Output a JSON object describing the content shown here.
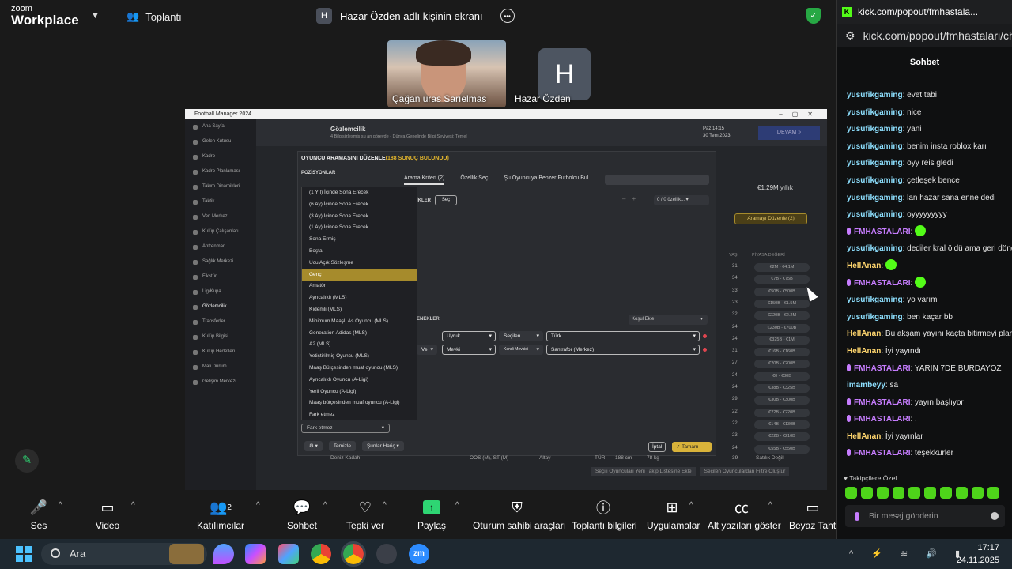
{
  "zoom": {
    "logo_top": "zoom",
    "logo_bottom": "Workplace",
    "meeting": "Toplantı",
    "shared_screen_title": "Hazar Özden adlı kişinin ekranı",
    "h_initial": "H"
  },
  "participants": [
    {
      "name": "Çağan uras Sarıelmas"
    },
    {
      "name": "Hazar Özden",
      "initial": "H"
    }
  ],
  "fm": {
    "window_title": "Football Manager 2024",
    "search_title": "Gözlemcilik",
    "search_sub": "4 Bilgisizleşmiş şu an görevde - Dünya Genelinde Bilgi Seviyesi: Temel",
    "date_line1": "Paz 14:15",
    "date_line2": "30 Tem 2023",
    "continue": "DEVAM",
    "sidebar": [
      "Ana Sayfa",
      "Gelen Kutusu",
      "Kadro",
      "Kadro Planlaması",
      "Takım Dinamikleri",
      "Taktik",
      "Veri Merkezi",
      "Kulüp Çalışanları",
      "Antrenman",
      "Sağlık Merkezi",
      "Fikstür",
      "Lig/Kupa",
      "Gözlemcilik",
      "Transferler",
      "Kulüp Bilgisi",
      "Kulüp Hedefleri",
      "Mali Durum",
      "Gelişim Merkezi"
    ],
    "dialog": {
      "title": "OYUNCU ARAMASINI DÜZENLE",
      "count": "(188 SONUÇ BULUNDU)",
      "positions": "POZİSYONLAR",
      "tabs": [
        "Arama Kriteri (2)",
        "Özellik Seç"
      ],
      "similar": "Şu Oyuncuya Benzer Futbolcu Bul",
      "ikler": "İKLER",
      "select_btn": "Seç",
      "features": "0 / 0 özellik...",
      "options_label": "ENEKLER",
      "add_condition": "Koşul Ekle",
      "row1": {
        "a": "Uyruk",
        "b": "Seçilen",
        "c": "Türk"
      },
      "connector": "Ve",
      "row2": {
        "a": "Mevki",
        "b": "Kendi Mevkisi",
        "c": "Santrafor (Merkez)"
      },
      "dropdown_selected": "Fark etmez",
      "clear": "Temizle",
      "exclude": "Şunlar Hariç",
      "cancel": "İptal",
      "ok": "Tamam"
    },
    "dropdown_options": [
      "(1 Yıl) İçinde Sona Erecek",
      "(6 Ay) İçinde Sona Erecek",
      "(3 Ay) İçinde Sona Erecek",
      "(1 Ay) İçinde Sona Erecek",
      "Sona Ermiş",
      "Boşta",
      "Ucu Açık Sözleşme",
      "Genç",
      "Amatör",
      "Ayrıcalıklı (MLS)",
      "Kıdemli (MLS)",
      "Minimum Maaşlı As Oyuncu (MLS)",
      "Generation Adidas (MLS)",
      "A2 (MLS)",
      "Yetiştirilmiş Oyuncu (MLS)",
      "Maaş Bütçesinden muaf oyuncu (MLS)",
      "Ayrıcalıklı Oyuncu (A-Ligi)",
      "Yerli Oyuncu (A-Ligi)",
      "Maaş bütçesinden muaf oyuncu (A-Ligi)",
      "Fark etmez"
    ],
    "selected_option": "Genç",
    "right_header": {
      "age": "YAŞ",
      "value": "PİYASA DEĞERİ",
      "balance": "€1.29M yıllık",
      "edit_search": "Aramayı Düzenle (2)"
    },
    "ages": [
      "31",
      "34",
      "33",
      "23",
      "32",
      "24",
      "24",
      "31",
      "27",
      "24",
      "24",
      "29",
      "22",
      "22",
      "23",
      "24",
      "39"
    ],
    "values": [
      "€2M - €4.1M",
      "€7B - €75B",
      "€50B - €500B",
      "€150B - €1.5M",
      "€220B - €2.2M",
      "€230B - €700B",
      "€325B - €1M",
      "€16B - €160B",
      "€20B - €200B",
      "€0 - €80B",
      "€38B - €325B",
      "€30B - €300B",
      "€22B - €220B",
      "€14B - €130B",
      "€22B - €210B",
      "€55B - €550B",
      "Satılık Değil"
    ],
    "bottom_row": {
      "name": "Deniz Kadah",
      "pos": "OOS (M), ST (M)",
      "club": "Altay",
      "nat": "TÜR",
      "height": "188 cm",
      "weight": "78 kg"
    },
    "action_left": "Seçili Oyuncuları Yeni Takip Listesine Ekle",
    "action_right": "Seçilen Oyunculardan Filtre Oluştur"
  },
  "browser": {
    "tab_title": "kick.com/popout/fmhastala...",
    "url": "kick.com/popout/fmhastalari/ch",
    "chat_title": "Sohbet",
    "followers_label": "Takipçilere Özel",
    "input_placeholder": "Bir mesaj gönderin"
  },
  "chat": [
    {
      "user": "yusufikgaming",
      "text": ": evet tabi",
      "color": "#8ee0ff"
    },
    {
      "user": "yusufikgaming",
      "text": ": nice",
      "color": "#8ee0ff"
    },
    {
      "user": "yusufikgaming",
      "text": ": yani",
      "color": "#8ee0ff"
    },
    {
      "user": "yusufikgaming",
      "text": ": benim insta roblox karı",
      "color": "#8ee0ff"
    },
    {
      "user": "yusufikgaming",
      "text": ": oyy reis gledi",
      "color": "#8ee0ff"
    },
    {
      "user": "yusufikgaming",
      "text": ": çetleşek bence",
      "color": "#8ee0ff"
    },
    {
      "user": "yusufikgaming",
      "text": ": lan hazar sana enne dedi",
      "color": "#8ee0ff"
    },
    {
      "user": "yusufikgaming",
      "text": ": oyyyyyyyyy",
      "color": "#8ee0ff"
    },
    {
      "user": "FMHASTALARI",
      "text": ": ",
      "color": "#c77dff",
      "mod": true,
      "emote": true
    },
    {
      "user": "yusufikgaming",
      "text": ": dediler kral öldü ama geri döndü",
      "color": "#8ee0ff"
    },
    {
      "user": "HellAnan",
      "text": ": ",
      "color": "#ffd66e",
      "emote": true
    },
    {
      "user": "FMHASTALARI",
      "text": ": ",
      "color": "#c77dff",
      "mod": true,
      "emote": true
    },
    {
      "user": "yusufikgaming",
      "text": ": yo varım",
      "color": "#8ee0ff"
    },
    {
      "user": "yusufikgaming",
      "text": ": ben kaçar bb",
      "color": "#8ee0ff"
    },
    {
      "user": "HellAnan",
      "text": ": Bu akşam yayını kaçta bitirmeyi planlıy",
      "color": "#ffd66e"
    },
    {
      "user": "HellAnan",
      "text": ": İyi yayındı",
      "color": "#ffd66e"
    },
    {
      "user": "FMHASTALARI",
      "text": ": YARIN 7DE BURDAYOZ",
      "color": "#c77dff",
      "mod": true
    },
    {
      "user": "imambeyy",
      "text": ": sa",
      "color": "#8ee0ff"
    },
    {
      "user": "FMHASTALARI",
      "text": ": yayın başlıyor",
      "color": "#c77dff",
      "mod": true
    },
    {
      "user": "FMHASTALARI",
      "text": ": .",
      "color": "#c77dff",
      "mod": true
    },
    {
      "user": "HellAnan",
      "text": ": İyi yayınlar",
      "color": "#ffd66e"
    },
    {
      "user": "FMHASTALARI",
      "text": ": teşekkürler",
      "color": "#c77dff",
      "mod": true
    }
  ],
  "toolbar": {
    "audio": "Ses",
    "video": "Video",
    "participants": "Katılımcılar",
    "participants_count": "2",
    "chat": "Sohbet",
    "react": "Tepki ver",
    "share": "Paylaş",
    "host_tools": "Oturum sahibi araçları",
    "meeting_info": "Toplantı bilgileri",
    "apps": "Uygulamalar",
    "captions": "Alt yazıları göster",
    "whiteboard": "Beyaz Tahta"
  },
  "taskbar": {
    "search": "Ara",
    "time": "17:17",
    "date": "24.11.2025"
  },
  "colors": {
    "accent_green": "#2ed573",
    "kick_green": "#53fc18",
    "fm_gold": "#d9b33a"
  }
}
